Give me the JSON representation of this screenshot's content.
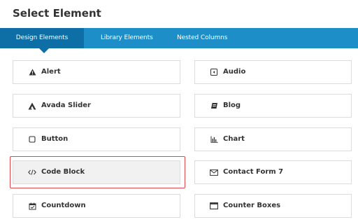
{
  "dialog": {
    "title": "Select Element"
  },
  "tabs": [
    {
      "label": "Design Elements",
      "active": true
    },
    {
      "label": "Library Elements",
      "active": false
    },
    {
      "label": "Nested Columns",
      "active": false
    }
  ],
  "elements": {
    "left": [
      {
        "label": "Alert",
        "icon": "alert-triangle-icon"
      },
      {
        "label": "Avada Slider",
        "icon": "avada-logo-icon"
      },
      {
        "label": "Button",
        "icon": "button-square-icon"
      },
      {
        "label": "Code Block",
        "icon": "code-icon",
        "selected": true
      },
      {
        "label": "Countdown",
        "icon": "calendar-check-icon"
      }
    ],
    "right": [
      {
        "label": "Audio",
        "icon": "audio-player-icon"
      },
      {
        "label": "Blog",
        "icon": "blog-icon"
      },
      {
        "label": "Chart",
        "icon": "bar-chart-icon"
      },
      {
        "label": "Contact Form 7",
        "icon": "envelope-icon"
      },
      {
        "label": "Counter Boxes",
        "icon": "window-icon"
      }
    ]
  },
  "colors": {
    "tabbar": "#1e8ec9",
    "active_tab": "#0e6fa6",
    "highlight": "#e2454c"
  }
}
